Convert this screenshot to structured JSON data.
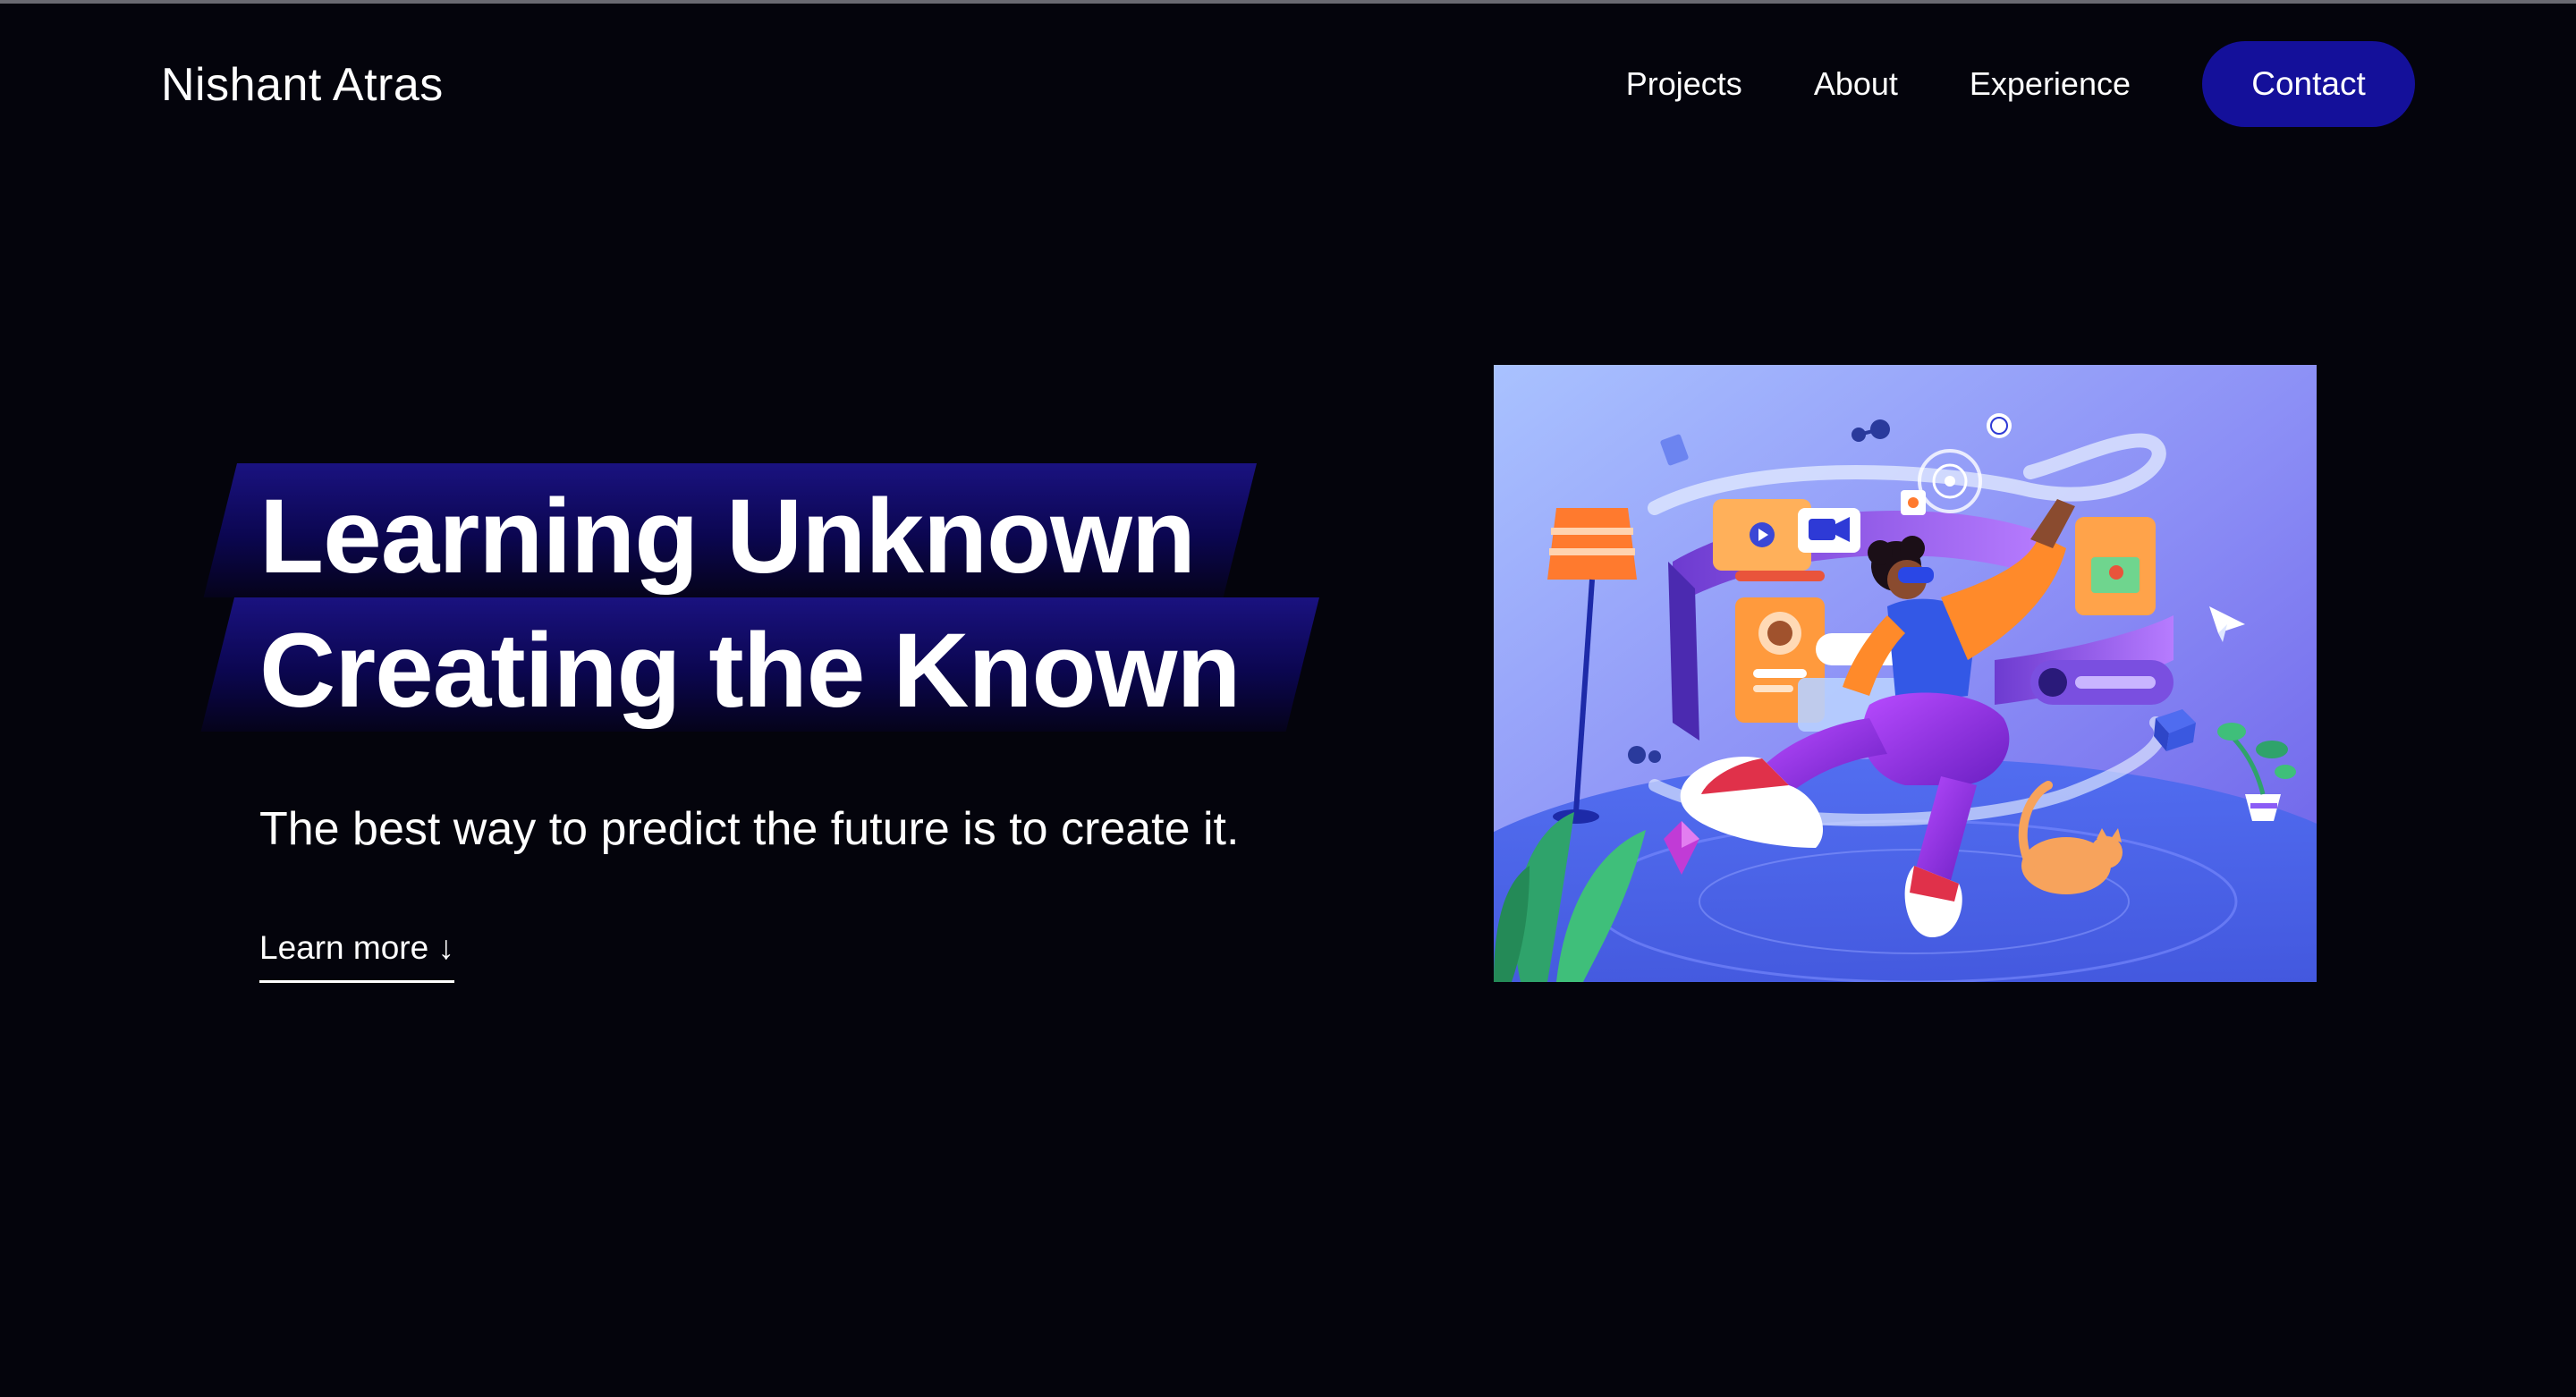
{
  "header": {
    "brand": "Nishant Atras",
    "nav": {
      "projects": "Projects",
      "about": "About",
      "experience": "Experience",
      "contact": "Contact"
    }
  },
  "hero": {
    "line1": "Learning Unknown",
    "line2": "Creating the Known",
    "tagline": "The best way to predict the future is to create it.",
    "cta": "Learn more ↓"
  },
  "illustration": {
    "icon": "vr-person-illustration",
    "colors": {
      "background_top": "#9bb5ff",
      "background_bottom": "#5c5ce6",
      "accent_orange": "#ff7a1a",
      "accent_purple": "#8a3fd6"
    }
  },
  "colors": {
    "page_background": "#04040c",
    "contact_button": "#14109a",
    "heading_band": "#140c6e"
  }
}
